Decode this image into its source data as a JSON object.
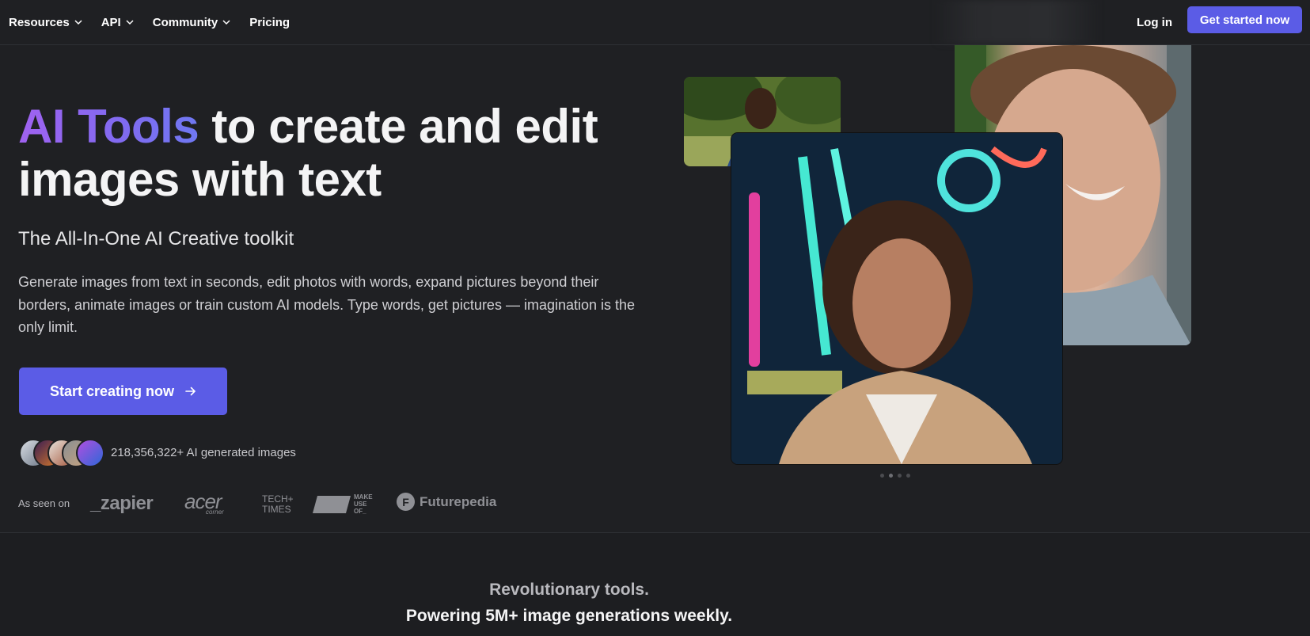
{
  "nav": {
    "items": [
      {
        "label": "Resources",
        "dropdown": true
      },
      {
        "label": "API",
        "dropdown": true
      },
      {
        "label": "Community",
        "dropdown": true
      },
      {
        "label": "Pricing",
        "dropdown": false
      }
    ],
    "login": "Log in",
    "get_started": "Get started now"
  },
  "hero": {
    "title_accent": "AI Tools",
    "title_rest_line1": "to create and edit",
    "title_line2": "images with text",
    "subtitle": "The All-In-One AI Creative toolkit",
    "description": "Generate images from text in seconds, edit photos with words, expand pictures beyond their borders, animate images or train custom AI models. Type words, get pictures — imagination is the only limit.",
    "cta": "Start creating now",
    "generated_count": "218,356,322+ AI generated images"
  },
  "as_seen_on": {
    "label": "As seen on",
    "logos": {
      "zapier": "_zapier",
      "acer": "acer",
      "acer_sub": "corner",
      "tech_line1": "TECH+",
      "tech_line2": "TIMES",
      "muo_line1": "MAKE",
      "muo_line2": "USE",
      "muo_line3": "OF_",
      "futurepedia": "Futurepedia",
      "futurepedia_badge": "F"
    }
  },
  "carousel": {
    "slides": 4,
    "active_index": 1
  },
  "section": {
    "line1": "Revolutionary tools.",
    "line2": "Powering 5M+ image generations weekly."
  },
  "colors": {
    "accent": "#5b5ce6",
    "background": "#1f2023",
    "gradient_start": "#a062f0",
    "gradient_end": "#6f78f2"
  }
}
